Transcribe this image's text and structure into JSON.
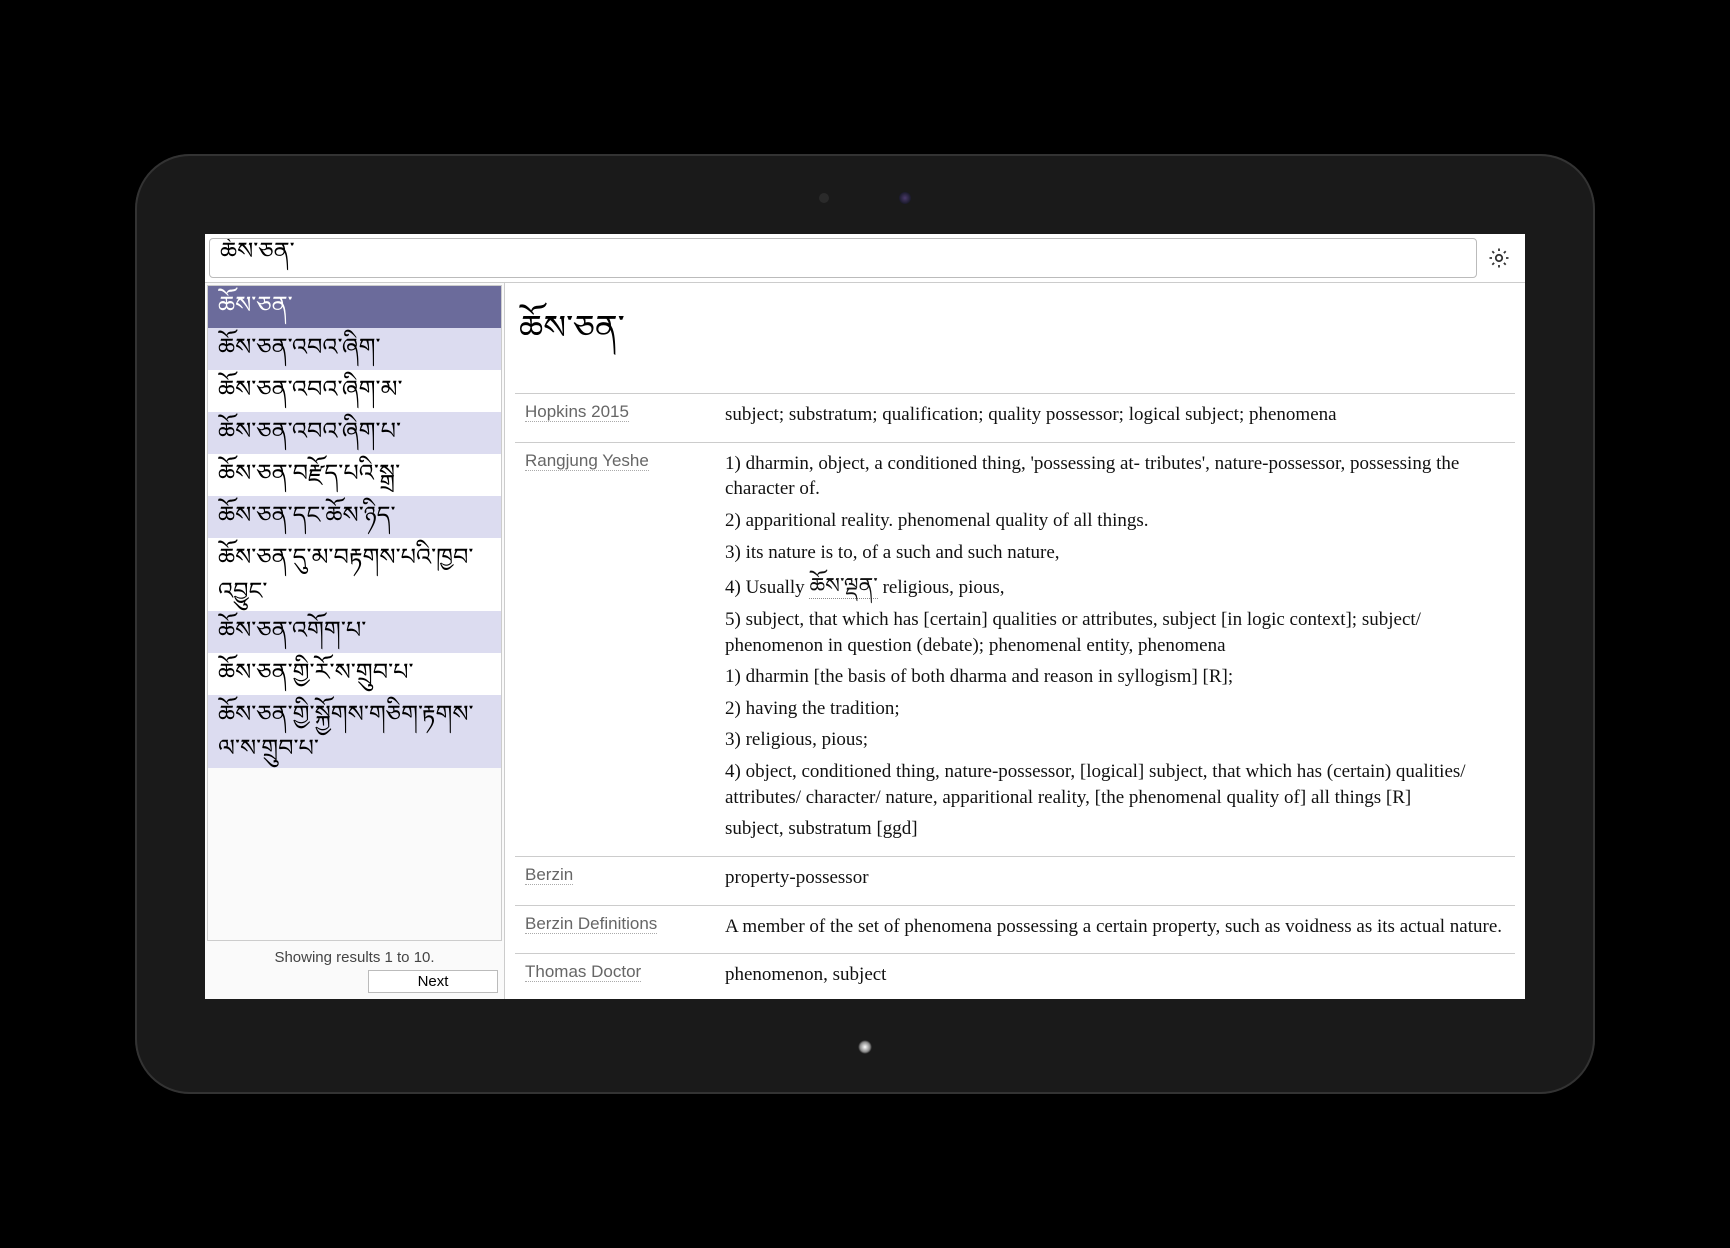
{
  "search": {
    "value": "ཆོས་ཅན་"
  },
  "sidebar": {
    "results": [
      "ཆོས་ཅན་",
      "ཆོས་ཅན་འབའ་ཞིག་",
      "ཆོས་ཅན་འབའ་ཞིག་མ་",
      "ཆོས་ཅན་འབའ་ཞིག་པ་",
      "ཆོས་ཅན་བརྫོད་པའི་སྒྲ་",
      "ཆོས་ཅན་དང་ཆོས་ཉིད་",
      "ཆོས་ཅན་དུ་མ་བརྟགས་པའི་ཁྱབ་འབྱུང་",
      "ཆོས་ཅན་འགོག་པ་",
      "ཆོས་ཅན་གྱི་རོ་ས་གྲུབ་པ་",
      "ཆོས་ཅན་གྱི་སྐྱོགས་གཅིག་རྟགས་ལ་ས་གྲུབ་པ་"
    ],
    "pager_text": "Showing results 1 to 10.",
    "next_label": "Next"
  },
  "entry": {
    "headword": "ཆོས་ཅན་",
    "rows": [
      {
        "source": "Hopkins 2015",
        "paras": [
          "subject; substratum; qualification; quality possessor; logical subject; phenomena"
        ]
      },
      {
        "source": "Rangjung Yeshe",
        "paras": [
          "1) dharmin, object, a conditioned thing, 'possessing at- tributes', nature-possessor, possessing the character of.",
          "2) apparitional reality. phenomenal quality of all things.",
          "3) its nature is to, of a such and such nature,",
          "4) Usually [[TIB:ཆོས་ལྡན་]] religious, pious,",
          "5) subject, that which has [certain] qualities or attributes, subject [in logic context]; subject/ phenomenon in question (debate); phenomenal entity, phenomena",
          "1) dharmin [the basis of both dharma and reason in syllogism] [R];",
          "2) having the tradition;",
          "3) religious, pious;",
          "4) object, conditioned thing, nature-possessor, [logical] subject, that which has (certain) qualities/ attributes/ character/ nature, apparitional reality, [the phenomenal quality of] all things [R]",
          "subject, substratum [ggd]"
        ]
      },
      {
        "source": "Berzin",
        "paras": [
          "property-possessor"
        ]
      },
      {
        "source": "Berzin Definitions",
        "paras": [
          "A member of the set of phenomena possessing a certain property, such as voidness as its actual nature."
        ]
      },
      {
        "source": "Thomas Doctor",
        "paras": [
          "phenomenon, subject"
        ]
      }
    ]
  }
}
